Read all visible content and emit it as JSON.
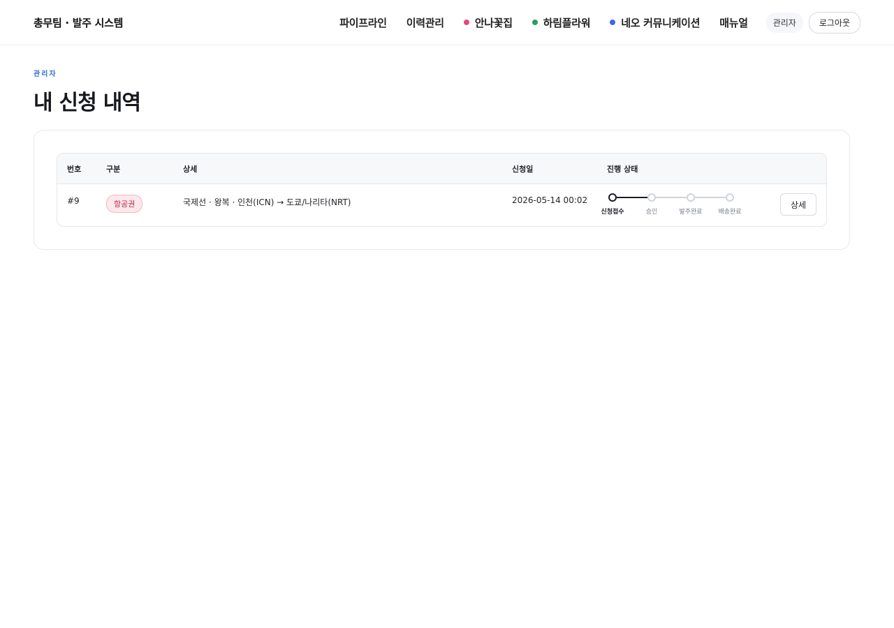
{
  "header": {
    "brand": "총무팀 · 발주 시스템",
    "nav": [
      {
        "label": "파이프라인",
        "dot": null
      },
      {
        "label": "이력관리",
        "dot": null
      },
      {
        "label": "안나꽃집",
        "dot": "#e8457c"
      },
      {
        "label": "하림플라워",
        "dot": "#22a060"
      },
      {
        "label": "네오 커뮤니케이션",
        "dot": "#3f66e6"
      },
      {
        "label": "매뉴얼",
        "dot": null
      }
    ],
    "role_badge": "관리자",
    "logout_label": "로그아웃"
  },
  "page": {
    "eyebrow": "관리자",
    "title": "내 신청 내역"
  },
  "table": {
    "columns": [
      "번호",
      "구분",
      "상세",
      "신청일",
      "진행 상태"
    ],
    "rows": [
      {
        "number": "#9",
        "category": "항공권",
        "detail": "국제선 · 왕복 · 인천(ICN) → 도쿄/나리타(NRT)",
        "date": "2026-05-14 00:02",
        "steps": [
          "신청접수",
          "승인",
          "발주완료",
          "배송완료"
        ],
        "current_step": 0,
        "action_label": "상세"
      }
    ]
  },
  "colors": {
    "accent": "#2f6fd6",
    "tag_text": "#b1294a",
    "tag_bg": "#fde8ec"
  }
}
